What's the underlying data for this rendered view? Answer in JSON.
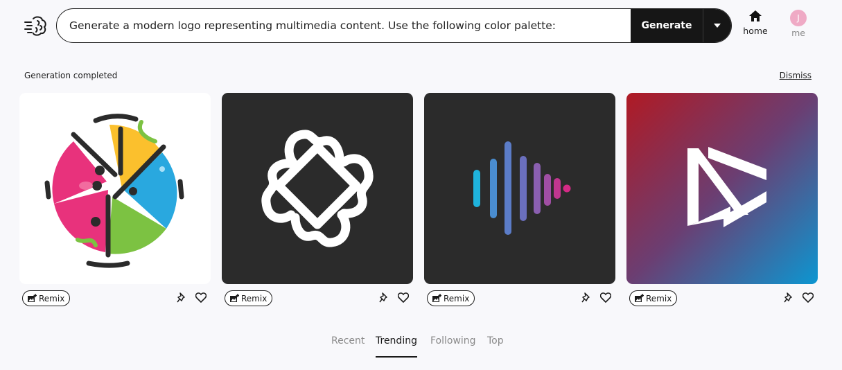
{
  "header": {
    "logo_icon": "brain-icon",
    "prompt_value": "Generate a modern logo representing multimedia content. Use the following color palette:",
    "generate_label": "Generate",
    "dropdown_icon": "caret-down-icon",
    "nav": {
      "home_label": "home",
      "home_icon": "home-icon",
      "me_label": "me",
      "avatar_initial": "J"
    }
  },
  "status": {
    "message": "Generation completed",
    "dismiss_label": "Dismiss"
  },
  "results": [
    {
      "image": "colorful-circular-logo",
      "remix_label": "Remix",
      "pin_icon": "pin-icon",
      "like_icon": "heart-icon"
    },
    {
      "image": "white-outline-logo-dark",
      "remix_label": "Remix",
      "pin_icon": "pin-icon",
      "like_icon": "heart-icon"
    },
    {
      "image": "soundwave-logo-dark",
      "remix_label": "Remix",
      "pin_icon": "pin-icon",
      "like_icon": "heart-icon"
    },
    {
      "image": "play-triangle-logo-gradient",
      "remix_label": "Remix",
      "pin_icon": "pin-icon",
      "like_icon": "heart-icon"
    }
  ],
  "tabs": [
    {
      "label": "Recent",
      "active": false
    },
    {
      "label": "Trending",
      "active": true
    },
    {
      "label": "Following",
      "active": false
    },
    {
      "label": "Top",
      "active": false
    }
  ],
  "colors": {
    "button_bg": "#161616",
    "avatar_bg": "#efaac5",
    "page_bg": "#f8f8fb"
  }
}
